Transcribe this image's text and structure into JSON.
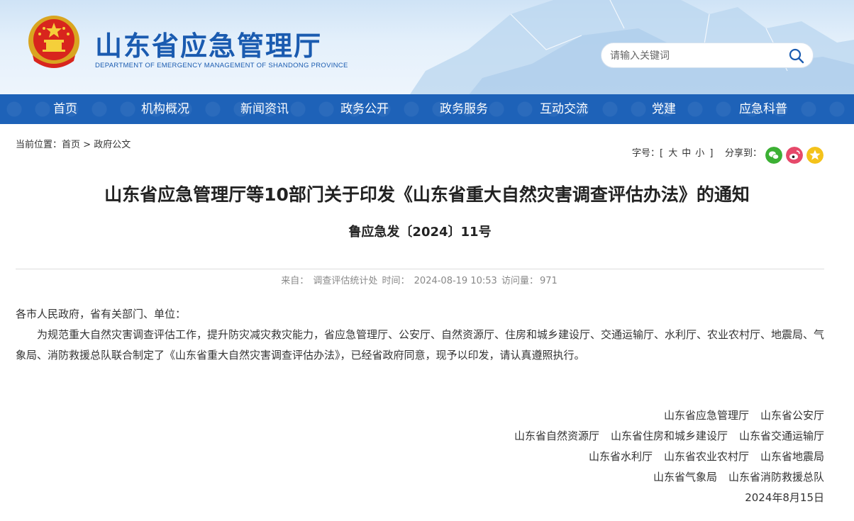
{
  "header": {
    "title": "山东省应急管理厅",
    "subtitle": "DEPARTMENT OF EMERGENCY MANAGEMENT OF SHANDONG PROVINCE",
    "emblem_icon": "national-emblem-icon",
    "search": {
      "placeholder": "请输入关键词"
    }
  },
  "nav": {
    "items": [
      "首页",
      "机构概况",
      "新闻资讯",
      "政务公开",
      "政务服务",
      "互动交流",
      "党建",
      "应急科普"
    ]
  },
  "breadcrumb": {
    "label": "当前位置：",
    "items": [
      "首页",
      "政府公文"
    ],
    "separator": ">"
  },
  "tools": {
    "font_label": "字号：",
    "font_open": "[",
    "font_options": [
      "大",
      "中",
      "小"
    ],
    "font_close": "]",
    "share_label": "分享到：",
    "share_icons": [
      {
        "name": "wechat-icon",
        "color": "#3cb034"
      },
      {
        "name": "weibo-icon",
        "color": "#e6496a"
      },
      {
        "name": "qzone-star-icon",
        "color": "#f4c21a"
      }
    ]
  },
  "article": {
    "title": "山东省应急管理厅等10部门关于印发《山东省重大自然灾害调查评估办法》的通知",
    "doc_number": "鲁应急发〔2024〕11号",
    "meta": {
      "source_label": "来自：",
      "source": "调查评估统计处",
      "time_label": "时间：",
      "time": "2024-08-19 10:53",
      "views_label": "访问量：",
      "views": "971"
    },
    "salutation": "各市人民政府，省有关部门、单位：",
    "paragraph": "为规范重大自然灾害调查评估工作，提升防灾减灾救灾能力，省应急管理厅、公安厅、自然资源厅、住房和城乡建设厅、交通运输厅、水利厅、农业农村厅、地震局、气象局、消防救援总队联合制定了《山东省重大自然灾害调查评估办法》，已经省政府同意，现予以印发，请认真遵照执行。",
    "signers": [
      [
        "山东省应急管理厅",
        "山东省公安厅"
      ],
      [
        "山东省自然资源厅",
        "山东省住房和城乡建设厅",
        "山东省交通运输厅"
      ],
      [
        "山东省水利厅",
        "山东省农业农村厅",
        "山东省地震局"
      ],
      [
        "山东省气象局",
        "山东省消防救援总队"
      ]
    ],
    "date": "2024年8月15日"
  },
  "colors": {
    "brand_blue": "#1a5bb0",
    "nav_blue": "#1e62b8"
  }
}
